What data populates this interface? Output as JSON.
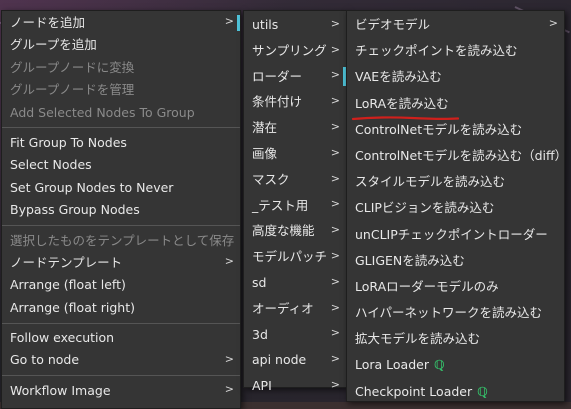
{
  "menu1": {
    "items": [
      {
        "label": "ノードを追加",
        "arrow": true,
        "highlight": true
      },
      {
        "label": "グループを追加"
      },
      {
        "label": "グループノードに変換",
        "disabled": true
      },
      {
        "label": "グループノードを管理",
        "disabled": true
      },
      {
        "label": "Add Selected Nodes To Group",
        "disabled": true
      },
      {
        "sep": true
      },
      {
        "label": "Fit Group To Nodes"
      },
      {
        "label": "Select Nodes"
      },
      {
        "label": "Set Group Nodes to Never"
      },
      {
        "label": "Bypass Group Nodes"
      },
      {
        "sep": true
      },
      {
        "label": "選択したものをテンプレートとして保存",
        "disabled": true
      },
      {
        "label": "ノードテンプレート",
        "arrow": true
      },
      {
        "label": "Arrange (float left)"
      },
      {
        "label": "Arrange (float right)"
      },
      {
        "sep": true
      },
      {
        "label": "Follow execution"
      },
      {
        "label": "Go to node",
        "arrow": true
      },
      {
        "sep": true
      },
      {
        "label": "Workflow Image",
        "arrow": true
      }
    ]
  },
  "menu2": {
    "items": [
      {
        "label": "utils",
        "arrow": true
      },
      {
        "label": "サンプリング",
        "arrow": true
      },
      {
        "label": "ローダー",
        "arrow": true,
        "highlight": true
      },
      {
        "label": "条件付け",
        "arrow": true
      },
      {
        "label": "潜在",
        "arrow": true
      },
      {
        "label": "画像",
        "arrow": true
      },
      {
        "label": "マスク",
        "arrow": true
      },
      {
        "label": "_テスト用",
        "arrow": true
      },
      {
        "label": "高度な機能",
        "arrow": true
      },
      {
        "label": "モデルパッチ",
        "arrow": true
      },
      {
        "label": "sd",
        "arrow": true
      },
      {
        "label": "オーディオ",
        "arrow": true
      },
      {
        "label": "3d",
        "arrow": true
      },
      {
        "label": "api node",
        "arrow": true
      },
      {
        "label": "API",
        "arrow": true
      }
    ]
  },
  "menu3": {
    "items": [
      {
        "label": "ビデオモデル",
        "arrow": true
      },
      {
        "label": "チェックポイントを読み込む"
      },
      {
        "label": "VAEを読み込む"
      },
      {
        "label": "LoRAを読み込む"
      },
      {
        "label": "ControlNetモデルを読み込む"
      },
      {
        "label": "ControlNetモデルを読み込む（diff）"
      },
      {
        "label": "スタイルモデルを読み込む"
      },
      {
        "label": "CLIPビジョンを読み込む"
      },
      {
        "label": "unCLIPチェックポイントローダー"
      },
      {
        "label": "GLIGENを読み込む"
      },
      {
        "label": "LoRAローダーモデルのみ"
      },
      {
        "label": "ハイパーネットワークを読み込む"
      },
      {
        "label": "拡大モデルを読み込む"
      },
      {
        "label": "Lora Loader",
        "badge": "ℚ"
      },
      {
        "label": "Checkpoint Loader",
        "badge": "ℚ"
      }
    ]
  },
  "colors": {
    "accent": "#4fc3d9",
    "annotation": "#d0201c",
    "badge": "#35c06a"
  }
}
